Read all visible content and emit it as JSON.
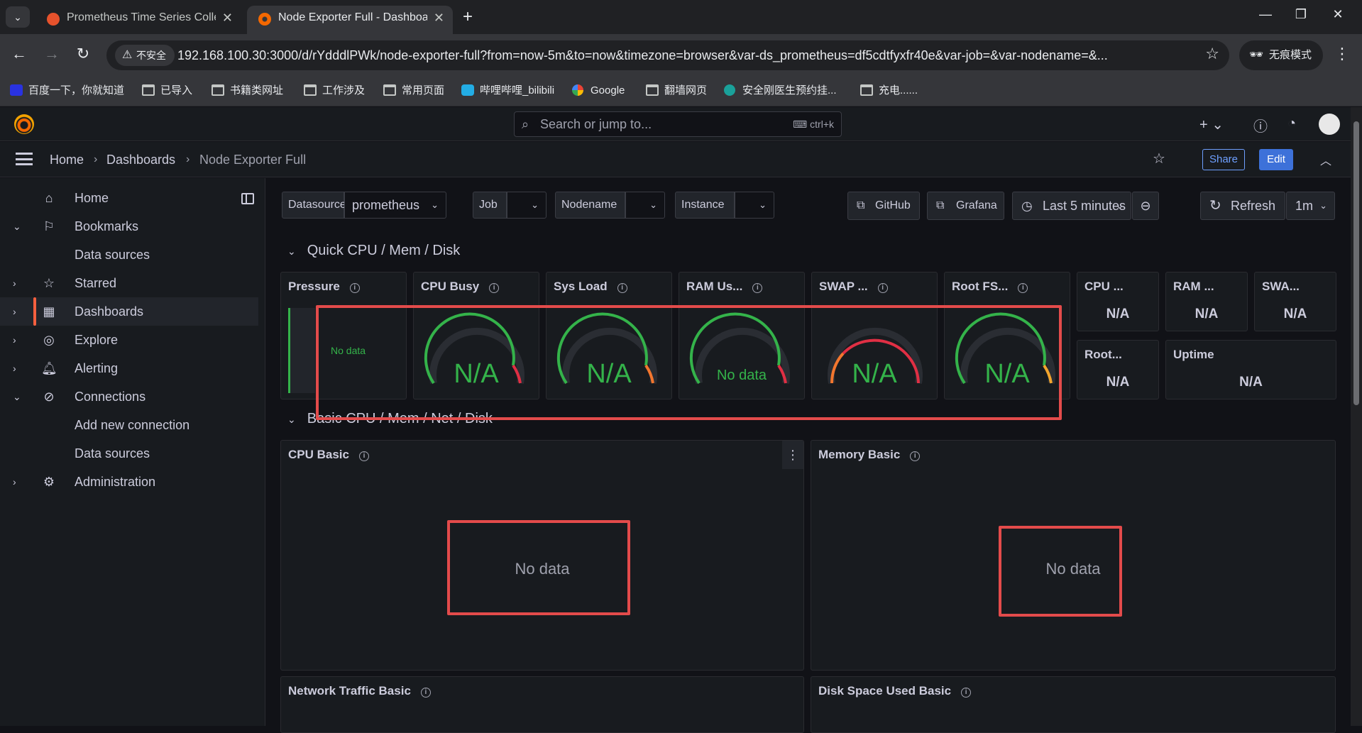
{
  "browser": {
    "tabs": [
      {
        "label": "Prometheus Time Series Colle",
        "active": false
      },
      {
        "label": "Node Exporter Full - Dashboa",
        "active": true
      }
    ],
    "insecure_label": "不安全",
    "url": "192.168.100.30:3000/d/rYdddlPWk/node-exporter-full?from=now-5m&to=now&timezone=browser&var-ds_prometheus=df5cdtfyxfr40e&var-job=&var-nodename=&...",
    "incognito_label": "无痕模式",
    "bookmarks": [
      "百度一下，你就知道",
      "已导入",
      "书籍类网址",
      "工作涉及",
      "常用页面",
      "哔哩哔哩_bilibili",
      "Google",
      "翻墙网页",
      "安全刚医生预约挂...",
      "充电......"
    ]
  },
  "grafana": {
    "search_placeholder": "Search or jump to...",
    "search_shortcut": "ctrl+k",
    "breadcrumb": [
      "Home",
      "Dashboards",
      "Node Exporter Full"
    ],
    "share_label": "Share",
    "edit_label": "Edit",
    "sidebar": {
      "items": [
        {
          "label": "Home",
          "icon": "home-icon"
        },
        {
          "label": "Bookmarks",
          "icon": "bookmark-icon"
        },
        {
          "label": "Data sources",
          "icon": ""
        },
        {
          "label": "Starred",
          "icon": "star-icon"
        },
        {
          "label": "Dashboards",
          "icon": "apps-icon"
        },
        {
          "label": "Explore",
          "icon": "compass-icon"
        },
        {
          "label": "Alerting",
          "icon": "bell-icon"
        },
        {
          "label": "Connections",
          "icon": "link-icon"
        },
        {
          "label": "Add new connection",
          "icon": ""
        },
        {
          "label": "Data sources",
          "icon": ""
        },
        {
          "label": "Administration",
          "icon": "cog-icon"
        }
      ]
    },
    "variables": {
      "datasource_label": "Datasource",
      "datasource_value": "prometheus",
      "job_label": "Job",
      "nodename_label": "Nodename",
      "instance_label": "Instance"
    },
    "toolbar": {
      "github_label": "GitHub",
      "grafana_label": "Grafana",
      "time_range": "Last 5 minutes",
      "refresh_label": "Refresh",
      "refresh_interval": "1m"
    },
    "rows": {
      "quick": "Quick CPU / Mem / Disk",
      "basic": "Basic CPU / Mem / Net / Disk"
    },
    "panels": {
      "pressure": {
        "title": "Pressure",
        "value": "No data"
      },
      "cpu_busy": {
        "title": "CPU Busy",
        "value": "N/A"
      },
      "sys_load": {
        "title": "Sys Load",
        "value": "N/A"
      },
      "ram_used": {
        "title": "RAM Us...",
        "value": "No data"
      },
      "swap_used": {
        "title": "SWAP ...",
        "value": "N/A"
      },
      "root_fs": {
        "title": "Root FS...",
        "value": "N/A"
      },
      "cpu_cores": {
        "title": "CPU ...",
        "value": "N/A"
      },
      "ram_total": {
        "title": "RAM ...",
        "value": "N/A"
      },
      "swap_total": {
        "title": "SWA...",
        "value": "N/A"
      },
      "root_total": {
        "title": "Root...",
        "value": "N/A"
      },
      "uptime": {
        "title": "Uptime",
        "value": "N/A"
      },
      "cpu_basic": {
        "title": "CPU Basic",
        "value": "No data"
      },
      "memory_basic": {
        "title": "Memory Basic",
        "value": "No data"
      },
      "network_basic": {
        "title": "Network Traffic Basic"
      },
      "disk_basic": {
        "title": "Disk Space Used Basic"
      }
    }
  },
  "colors": {
    "accent_orange": "#f55f3e",
    "gauge_green": "#34b34a",
    "gauge_red": "#e02f44",
    "highlight_red": "#e34b4b",
    "primary_blue": "#3d71d9"
  }
}
